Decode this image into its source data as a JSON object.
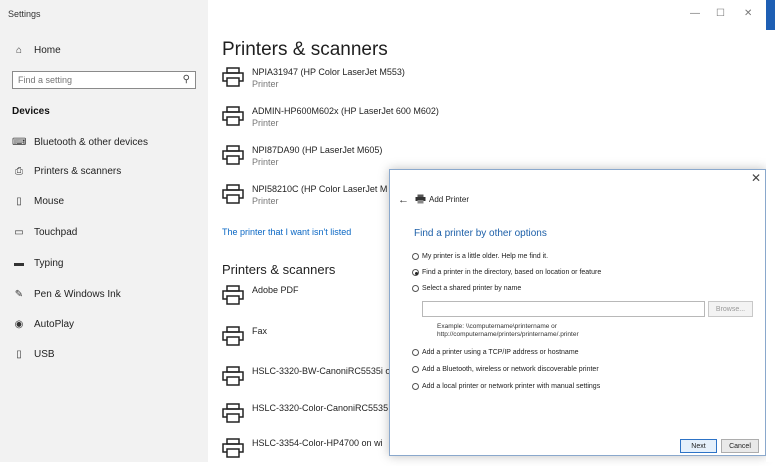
{
  "window": {
    "app_title": "Settings",
    "controls": {
      "minimize": "—",
      "maximize": "☐",
      "close": "✕"
    }
  },
  "sidebar": {
    "home": {
      "label": "Home",
      "icon": "home-icon"
    },
    "search": {
      "placeholder": "Find a setting",
      "icon": "search-icon"
    },
    "section": "Devices",
    "items": [
      {
        "label": "Bluetooth & other devices",
        "icon": "bluetooth-devices-icon"
      },
      {
        "label": "Printers & scanners",
        "icon": "printer-icon"
      },
      {
        "label": "Mouse",
        "icon": "mouse-icon"
      },
      {
        "label": "Touchpad",
        "icon": "touchpad-icon"
      },
      {
        "label": "Typing",
        "icon": "keyboard-icon"
      },
      {
        "label": "Pen & Windows Ink",
        "icon": "pen-icon"
      },
      {
        "label": "AutoPlay",
        "icon": "autoplay-icon"
      },
      {
        "label": "USB",
        "icon": "usb-icon"
      }
    ]
  },
  "main": {
    "title": "Printers & scanners",
    "printers": [
      {
        "name": "NPIA31947 (HP Color LaserJet M553)",
        "status": "Printer"
      },
      {
        "name": "ADMIN-HP600M602x (HP LaserJet 600 M602)",
        "status": "Printer"
      },
      {
        "name": "NPI87DA90 (HP LaserJet M605)",
        "status": "Printer"
      },
      {
        "name": "NPI58210C (HP Color LaserJet M",
        "status": "Printer"
      }
    ],
    "link": "The printer that I want isn't listed",
    "subtitle": "Printers & scanners",
    "printers2": [
      {
        "name": "Adobe PDF"
      },
      {
        "name": "Fax"
      },
      {
        "name": "HSLC-3320-BW-CanoniRC5535i o"
      },
      {
        "name": "HSLC-3320-Color-CanoniRC5535"
      },
      {
        "name": "HSLC-3354-Color-HP4700 on wi"
      }
    ]
  },
  "dialog": {
    "close": "✕",
    "back": "←",
    "title": "Add Printer",
    "heading": "Find a printer by other options",
    "options": [
      {
        "label": "My printer is a little older. Help me find it.",
        "selected": false
      },
      {
        "label": "Find a printer in the directory, based on location or feature",
        "selected": true
      },
      {
        "label": "Select a shared printer by name",
        "selected": false
      }
    ],
    "shared_input_value": "",
    "browse": "Browse...",
    "example_line1": "Example: \\\\computername\\printername or",
    "example_line2": "http://computername/printers/printername/.printer",
    "options2": [
      {
        "label": "Add a printer using a TCP/IP address or hostname",
        "selected": false
      },
      {
        "label": "Add a Bluetooth, wireless or network discoverable printer",
        "selected": false
      },
      {
        "label": "Add a local printer or network printer with manual settings",
        "selected": false
      }
    ],
    "next": "Next",
    "cancel": "Cancel"
  }
}
